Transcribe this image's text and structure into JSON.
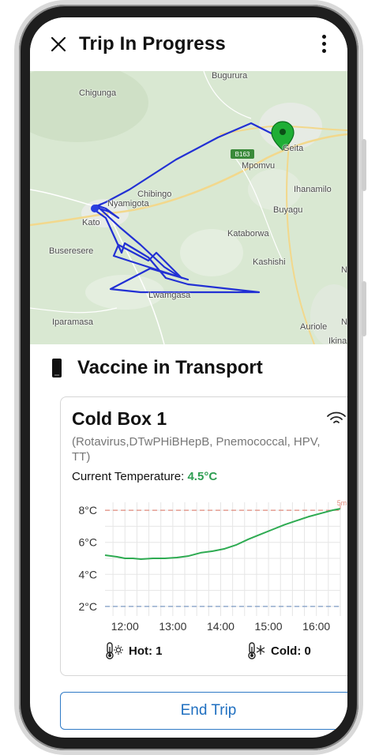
{
  "header": {
    "title": "Trip In Progress"
  },
  "map": {
    "places": {
      "bugurura": "Bugurura",
      "chigunga": "Chigunga",
      "geita": "Geita",
      "mpomvu": "Mpomvu",
      "ihanamilo": "Ihanamilo",
      "chibingo": "Chibingo",
      "nyamigota": "Nyamigota",
      "katoro": "Kato",
      "buyagu": "Buyagu",
      "kataborwa": "Kataborwa",
      "buseresere": "Buseresere",
      "kashishi": "Kashishi",
      "ny": "Ny",
      "lwamgasa": "Lwamgasa",
      "iparamasa": "Iparamasa",
      "auriole": "Auriole",
      "ny2": "Ny",
      "ikina": "Ikina"
    },
    "road_shield": "B163"
  },
  "section": {
    "title": "Vaccine in Transport"
  },
  "cold_box": {
    "name": "Cold Box 1",
    "vaccines": "(Rotavirus,DTwPHiBHepB, Pnemococcal, HPV, TT)",
    "temp_label": "Current Temperature: ",
    "temp_value": "4.5°C",
    "hot_label": "Hot: 1",
    "cold_label": "Cold: 0"
  },
  "chart_data": {
    "type": "line",
    "x": [
      "11:35",
      "11:50",
      "12:00",
      "12:10",
      "12:20",
      "12:35",
      "12:50",
      "13:05",
      "13:20",
      "13:35",
      "13:50",
      "14:05",
      "14:20",
      "14:35",
      "14:50",
      "15:05",
      "15:20",
      "15:35",
      "15:50",
      "16:05",
      "16:20",
      "16:30"
    ],
    "series": [
      {
        "values": [
          5.2,
          5.1,
          5.0,
          5.0,
          4.95,
          5.0,
          5.0,
          5.05,
          5.15,
          5.35,
          5.45,
          5.6,
          5.85,
          6.2,
          6.5,
          6.8,
          7.1,
          7.35,
          7.6,
          7.8,
          8.0,
          8.1
        ]
      }
    ],
    "xticks": [
      "12:00",
      "13:00",
      "14:00",
      "15:00",
      "16:00"
    ],
    "yticks": [
      "2°C",
      "4°C",
      "6°C",
      "8°C"
    ],
    "ylim": [
      1.6,
      8.5
    ],
    "thresholds": {
      "high": 8,
      "low": 2
    },
    "marker_label": "5m",
    "colors": {
      "line": "#2eab52",
      "high": "#e08b7d",
      "low": "#7d9bc4",
      "grid": "#e6e6e6"
    },
    "grid": true
  },
  "actions": {
    "end_trip": "End Trip"
  }
}
